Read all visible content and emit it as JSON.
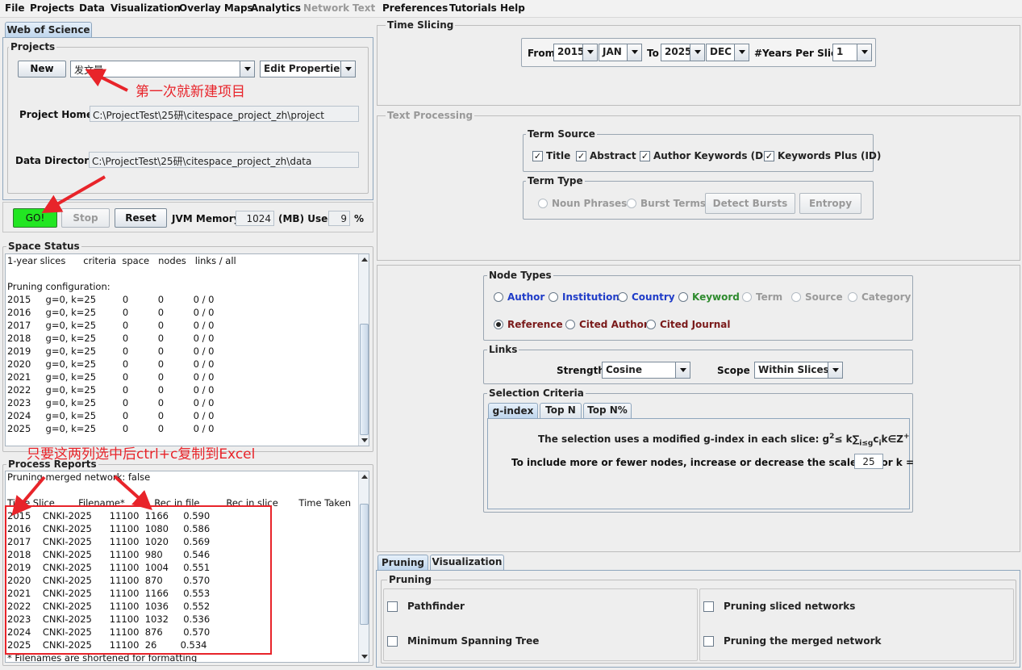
{
  "menu": {
    "items": [
      "File",
      "Projects",
      "Data",
      "Visualization",
      "Overlay Maps",
      "Analytics",
      "Network",
      "Text",
      "Preferences",
      "Tutorials",
      "Help"
    ],
    "disabled": [
      "Network",
      "Text"
    ]
  },
  "source_tab": "Web of Science",
  "projects": {
    "group_label": "Projects",
    "new_button": "New",
    "project_name": "发文量",
    "edit_properties": "Edit Properties",
    "project_home_label": "Project Home:",
    "project_home": "C:\\ProjectTest\\25研\\citespace_project_zh\\project",
    "data_directory_label": "Data Directory:",
    "data_directory": "C:\\ProjectTest\\25研\\citespace_project_zh\\data"
  },
  "controls": {
    "go": "GO!",
    "stop": "Stop",
    "reset": "Reset",
    "jvm_label": "JVM Memory",
    "jvm_value": "1024",
    "mb_used_label": "(MB) Used",
    "used_value": "9",
    "percent": "%"
  },
  "space_status": {
    "label": "Space Status",
    "lines": [
      "1-year slices      criteria  space   nodes   links / all",
      "",
      "Pruning configuration:",
      "2015     g=0, k=25         0          0          0 / 0",
      "2016     g=0, k=25         0          0          0 / 0",
      "2017     g=0, k=25         0          0          0 / 0",
      "2018     g=0, k=25         0          0          0 / 0",
      "2019     g=0, k=25         0          0          0 / 0",
      "2020     g=0, k=25         0          0          0 / 0",
      "2021     g=0, k=25         0          0          0 / 0",
      "2022     g=0, k=25         0          0          0 / 0",
      "2023     g=0, k=25         0          0          0 / 0",
      "2024     g=0, k=25         0          0          0 / 0",
      "2025     g=0, k=25         0          0          0 / 0"
    ]
  },
  "process_reports": {
    "label": "Process Reports",
    "lines": [
      "Pruning merged network: false",
      "",
      "Time Slice        Filename*          Rec in file         Rec in slice       Time Taken",
      "2015    CNKI-2025      11100  1166     0.590",
      "2016    CNKI-2025      11100  1080     0.586",
      "2017    CNKI-2025      11100  1020     0.569",
      "2018    CNKI-2025      11100  980       0.546",
      "2019    CNKI-2025      11100  1004     0.551",
      "2020    CNKI-2025      11100  870       0.570",
      "2021    CNKI-2025      11100  1166     0.553",
      "2022    CNKI-2025      11100  1036     0.552",
      "2023    CNKI-2025      11100  1032     0.536",
      "2024    CNKI-2025      11100  876       0.570",
      "2025    CNKI-2025      11100  26        0.534",
      "* Filenames are shortened for formatting"
    ]
  },
  "annotations": {
    "new_project": "第一次就新建项目",
    "copy_excel": "只要这两列选中后ctrl+c复制到Excel"
  },
  "time_slicing": {
    "label": "Time Slicing",
    "from_label": "From",
    "from_year": "2015",
    "from_month": "JAN",
    "to_label": "To",
    "to_year": "2025",
    "to_month": "DEC",
    "years_label": "#Years Per Slice",
    "years_value": "1"
  },
  "text_processing": {
    "label": "Text Processing",
    "term_source_label": "Term Source",
    "sources": [
      "Title",
      "Abstract",
      "Author Keywords (DE)",
      "Keywords Plus (ID)"
    ],
    "term_type_label": "Term Type",
    "noun_phrases": "Noun Phrases",
    "burst_terms": "Burst Terms",
    "detect_bursts": "Detect Bursts",
    "entropy": "Entropy"
  },
  "node_types": {
    "label": "Node Types",
    "row1": [
      "Author",
      "Institution",
      "Country",
      "Keyword",
      "Term",
      "Source",
      "Category"
    ],
    "row2": [
      "Reference",
      "Cited Author",
      "Cited Journal"
    ],
    "selected": "Reference",
    "colors": {
      "blue": "#1f3cc8",
      "green": "#2e8b2e",
      "gray": "#9a9a9a",
      "maroon": "#7a1a1a"
    }
  },
  "links": {
    "label": "Links",
    "strength_label": "Strength",
    "strength_value": "Cosine",
    "scope_label": "Scope",
    "scope_value": "Within Slices"
  },
  "selection_criteria": {
    "label": "Selection Criteria",
    "tabs": [
      "g-index",
      "Top N",
      "Top N%"
    ],
    "desc": "The selection uses a modified g-index in each slice: g",
    "formula_tail": "≤ k∑",
    "formula_end": "c",
    "formula_set": "k∈Z",
    "sup2": "2",
    "sub_i": "i≤g",
    "sub_c": "i",
    "sup_plus": "+",
    "scale_text": "To include more or fewer nodes, increase or decrease the scale factor k =",
    "k_value": "25"
  },
  "bottom_tabs": [
    "Pruning",
    "Visualization"
  ],
  "pruning": {
    "label": "Pruning",
    "pathfinder": "Pathfinder",
    "mst": "Minimum Spanning Tree",
    "sliced": "Pruning sliced networks",
    "merged": "Pruning the merged network"
  }
}
